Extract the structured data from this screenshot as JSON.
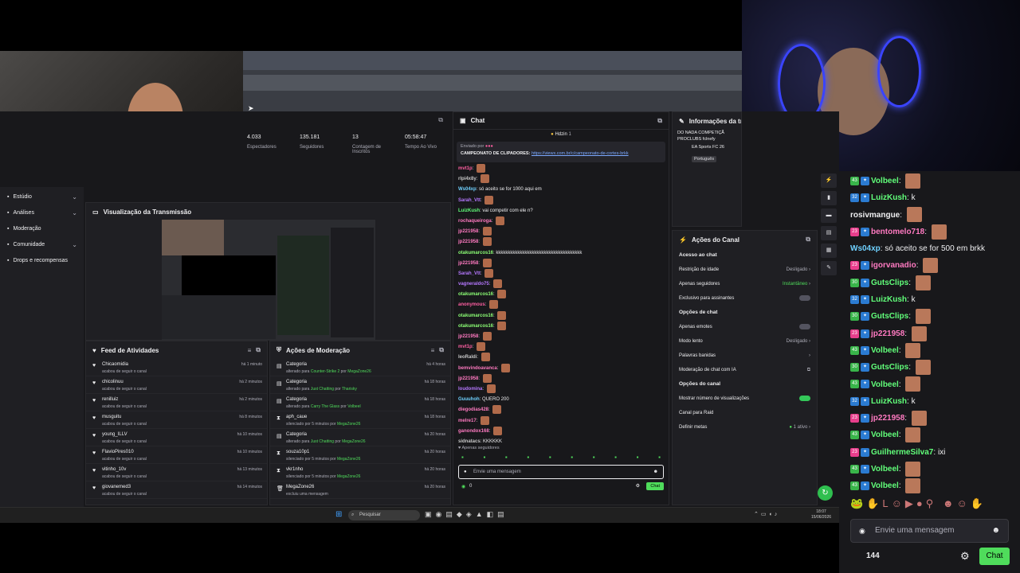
{
  "sidebar": {
    "items": [
      {
        "label": "Estúdio",
        "chevron": true
      },
      {
        "label": "Análises",
        "chevron": true
      },
      {
        "label": "Moderação",
        "chevron": false
      },
      {
        "label": "Comunidade",
        "chevron": true
      },
      {
        "label": "Drops e recompensas",
        "chevron": false
      }
    ]
  },
  "stats": [
    {
      "value": "4.033",
      "label": "Espectadores"
    },
    {
      "value": "135.181",
      "label": "Seguidores"
    },
    {
      "value": "13",
      "label": "Contagem de Inscritos"
    },
    {
      "value": "05:58:47",
      "label": "Tempo Ao Vivo"
    }
  ],
  "preview": {
    "title": "Visualização da Transmissão"
  },
  "activity": {
    "title": "Feed de Atividades",
    "rows": [
      {
        "name": "Chicaomidia",
        "sub": "acabou de seguir o canal",
        "time": "há 1 minuto"
      },
      {
        "name": "chicolinuu",
        "sub": "acabou de seguir o canal",
        "time": "há 2 minutos"
      },
      {
        "name": "renilluiz",
        "sub": "acabou de seguir o canal",
        "time": "há 2 minutos"
      },
      {
        "name": "musguitu",
        "sub": "acabou de seguir o canal",
        "time": "há 8 minutos"
      },
      {
        "name": "young_ILLV",
        "sub": "acabou de seguir o canal",
        "time": "há 10 minutos"
      },
      {
        "name": "FlavioPires010",
        "sub": "acabou de seguir o canal",
        "time": "há 10 minutos"
      },
      {
        "name": "vitinho_10v",
        "sub": "acabou de seguir o canal",
        "time": "há 13 minutos"
      },
      {
        "name": "giovanemed3",
        "sub": "acabou de seguir o canal",
        "time": "há 14 minutos"
      }
    ]
  },
  "modactions": {
    "title": "Ações de Moderação",
    "rows": [
      {
        "name": "Categoria",
        "pre": "alterado para ",
        "hl1": "Counter-Strike 2",
        "mid": " por ",
        "hl2": "MegaZone26",
        "time": "há 4 horas",
        "icon": "category"
      },
      {
        "name": "Categoria",
        "pre": "alterado para ",
        "hl1": "Just Chatting",
        "mid": " por ",
        "hl2": "Tharisky",
        "time": "há 18 horas",
        "icon": "category"
      },
      {
        "name": "Categoria",
        "pre": "alterado para ",
        "hl1": "Carry The Glass",
        "mid": " por ",
        "hl2": "Volbeel",
        "time": "há 18 horas",
        "icon": "category"
      },
      {
        "name": "aph_caue",
        "pre": "silenciado por 5 minutos por ",
        "hl1": "MegaZone26",
        "mid": "",
        "hl2": "",
        "time": "há 18 horas",
        "icon": "timeout"
      },
      {
        "name": "Categoria",
        "pre": "alterado para ",
        "hl1": "Just Chatting",
        "mid": " por ",
        "hl2": "MegaZone26",
        "time": "há 20 horas",
        "icon": "category"
      },
      {
        "name": "souza10p1",
        "pre": "silenciado por 5 minutos por ",
        "hl1": "MegaZone26",
        "mid": "",
        "hl2": "",
        "time": "há 20 horas",
        "icon": "timeout"
      },
      {
        "name": "vkr1nho",
        "pre": "silenciado por 5 minutos por ",
        "hl1": "MegaZone26",
        "mid": "",
        "hl2": "",
        "time": "há 20 horas",
        "icon": "timeout"
      },
      {
        "name": "MegaZone26",
        "pre": "excluiu uma mensagem",
        "hl1": "",
        "mid": "",
        "hl2": "",
        "time": "há 20 horas",
        "icon": "delete"
      }
    ]
  },
  "chat": {
    "title": "Chat",
    "top_user": "Hdzin",
    "top_count": "1",
    "pinned_label": "Enviado por",
    "pinned_text": "CAMPEONATO DE CLIPADORES:",
    "pinned_link": "https://viewx.com.br/c/campeonato-de-cortes-brkk",
    "messages": [
      {
        "user": "mvt1p",
        "color": "#ff5fa2",
        "text": ""
      },
      {
        "user": "rlpi4x8y",
        "color": "#c7c7c7",
        "text": ""
      },
      {
        "user": "Ws04xp",
        "color": "#6fd1ff",
        "text": "só aceito se for 1000 aqui em"
      },
      {
        "user": "Sarah_Vtt",
        "color": "#b678ff",
        "text": ""
      },
      {
        "user": "LuizKush",
        "color": "#61ff7a",
        "text": "vai competir com ele n?"
      },
      {
        "user": "rochaqueiroga",
        "color": "#ff7ac1",
        "text": ""
      },
      {
        "user": "jp221958",
        "color": "#ff7ac1",
        "text": ""
      },
      {
        "user": "jp221958",
        "color": "#ff7ac1",
        "text": ""
      },
      {
        "user": "otakumarcos16",
        "color": "#8cff75",
        "text": "kkkkkkkkkkkkkkkkkkkkkkkkkkkkkkkkkkkk"
      },
      {
        "user": "jp221958",
        "color": "#ff7ac1",
        "text": ""
      },
      {
        "user": "Sarah_Vtt",
        "color": "#b678ff",
        "text": ""
      },
      {
        "user": "vagneraldo75",
        "color": "#b678ff",
        "text": ""
      },
      {
        "user": "otakumarcos16",
        "color": "#8cff75",
        "text": ""
      },
      {
        "user": "anonymous",
        "color": "#ff5fa2",
        "text": ""
      },
      {
        "user": "otakumarcos16",
        "color": "#8cff75",
        "text": ""
      },
      {
        "user": "otakumarcos16",
        "color": "#8cff75",
        "text": ""
      },
      {
        "user": "jp221958",
        "color": "#ff7ac1",
        "text": ""
      },
      {
        "user": "mvt1p",
        "color": "#ff5fa2",
        "text": ""
      },
      {
        "user": "leoRaldi",
        "color": "#c7c7c7",
        "text": ""
      },
      {
        "user": "bemvindoavanca",
        "color": "#ff7ac1",
        "text": ""
      },
      {
        "user": "jp221958",
        "color": "#ff7ac1",
        "text": ""
      },
      {
        "user": "loudomina",
        "color": "#b678ff",
        "text": ""
      },
      {
        "user": "Guuuhoh",
        "color": "#6fd1ff",
        "text": "QUERO 200"
      },
      {
        "user": "diegodias428",
        "color": "#ff7ac1",
        "text": ""
      },
      {
        "user": "melre17",
        "color": "#ff7ac1",
        "text": ""
      },
      {
        "user": "ganondox168",
        "color": "#ff7ac1",
        "text": ""
      },
      {
        "user": "sidnatacs",
        "color": "#c7c7c7",
        "text": "KKKKKK"
      }
    ],
    "followers_only": "Apenas seguidores",
    "placeholder": "Envie uma mensagem",
    "points": "0",
    "send": "Chat"
  },
  "info": {
    "title": "Informações da tra",
    "stream_title": "DO NADA COMPETIÇÃ PROCLUBS fclnefy",
    "category": "EA Sports FC 26",
    "language": "Português"
  },
  "actions": {
    "title": "Ações do Canal",
    "sec1": "Acesso ao chat",
    "r1": "Restrição de idade",
    "r1v": "Desligado",
    "r2": "Apenas seguidores",
    "r2v": "Instantâneo",
    "r3": "Exclusivo para assinantes",
    "sec2": "Opções de chat",
    "r4": "Apenas emotes",
    "r5": "Modo lento",
    "r5v": "Desligado",
    "r6": "Palavras banidas",
    "r7": "Moderação de chat com IA",
    "sec3": "Opções do canal",
    "r8": "Mostrar número de visualizações",
    "r9": "Canal para Raid",
    "r10": "Definir metas",
    "r10v": "1 ativo"
  },
  "taskbar": {
    "search": "Pesquisar",
    "time": "18:07",
    "date": "15/06/2026"
  },
  "overlay": {
    "messages": [
      {
        "badge": "43",
        "bcolor": "#39b54a",
        "user": "Volbeel",
        "ucolor": "#61ff7a",
        "text": "",
        "emote": true
      },
      {
        "badge": "32",
        "bcolor": "#2b7bd1",
        "user": "LuizKush",
        "ucolor": "#61ff7a",
        "text": "k",
        "emote": false
      },
      {
        "badge": "",
        "bcolor": "",
        "user": "rosivmangue",
        "ucolor": "#efeff1",
        "text": "",
        "emote": true
      },
      {
        "badge": "23",
        "bcolor": "#e83e8c",
        "user": "bentomelo718",
        "ucolor": "#ff7ac1",
        "text": "",
        "emote": true
      },
      {
        "badge": "",
        "bcolor": "",
        "user": "Ws04xp",
        "ucolor": "#6fd1ff",
        "text": "só aceito se for 500 em brkk",
        "emote": false
      },
      {
        "badge": "23",
        "bcolor": "#e83e8c",
        "user": "igorvanadio",
        "ucolor": "#ff7ac1",
        "text": "",
        "emote": true
      },
      {
        "badge": "30",
        "bcolor": "#39b54a",
        "user": "GutsClips",
        "ucolor": "#61ff7a",
        "text": "",
        "emote": true
      },
      {
        "badge": "32",
        "bcolor": "#2b7bd1",
        "user": "LuizKush",
        "ucolor": "#61ff7a",
        "text": "k",
        "emote": false
      },
      {
        "badge": "30",
        "bcolor": "#39b54a",
        "user": "GutsClips",
        "ucolor": "#61ff7a",
        "text": "",
        "emote": true
      },
      {
        "badge": "23",
        "bcolor": "#e83e8c",
        "user": "jp221958",
        "ucolor": "#ff7ac1",
        "text": "",
        "emote": true
      },
      {
        "badge": "43",
        "bcolor": "#39b54a",
        "user": "Volbeel",
        "ucolor": "#61ff7a",
        "text": "",
        "emote": true
      },
      {
        "badge": "30",
        "bcolor": "#39b54a",
        "user": "GutsClips",
        "ucolor": "#61ff7a",
        "text": "",
        "emote": true
      },
      {
        "badge": "43",
        "bcolor": "#39b54a",
        "user": "Volbeel",
        "ucolor": "#61ff7a",
        "text": "",
        "emote": true
      },
      {
        "badge": "32",
        "bcolor": "#2b7bd1",
        "user": "LuizKush",
        "ucolor": "#61ff7a",
        "text": "k",
        "emote": false
      },
      {
        "badge": "23",
        "bcolor": "#e83e8c",
        "user": "jp221958",
        "ucolor": "#ff7ac1",
        "text": "",
        "emote": true
      },
      {
        "badge": "43",
        "bcolor": "#39b54a",
        "user": "Volbeel",
        "ucolor": "#61ff7a",
        "text": "",
        "emote": true
      },
      {
        "badge": "23",
        "bcolor": "#e83e8c",
        "user": "GuilhermeSilva7",
        "ucolor": "#61ff7a",
        "text": "ixi",
        "emote": false
      },
      {
        "badge": "43",
        "bcolor": "#39b54a",
        "user": "Volbeel",
        "ucolor": "#61ff7a",
        "text": "",
        "emote": true
      },
      {
        "badge": "43",
        "bcolor": "#39b54a",
        "user": "Volbeel",
        "ucolor": "#61ff7a",
        "text": "",
        "emote": true
      }
    ],
    "placeholder": "Envie uma mensagem",
    "viewers": "144",
    "send": "Chat"
  }
}
